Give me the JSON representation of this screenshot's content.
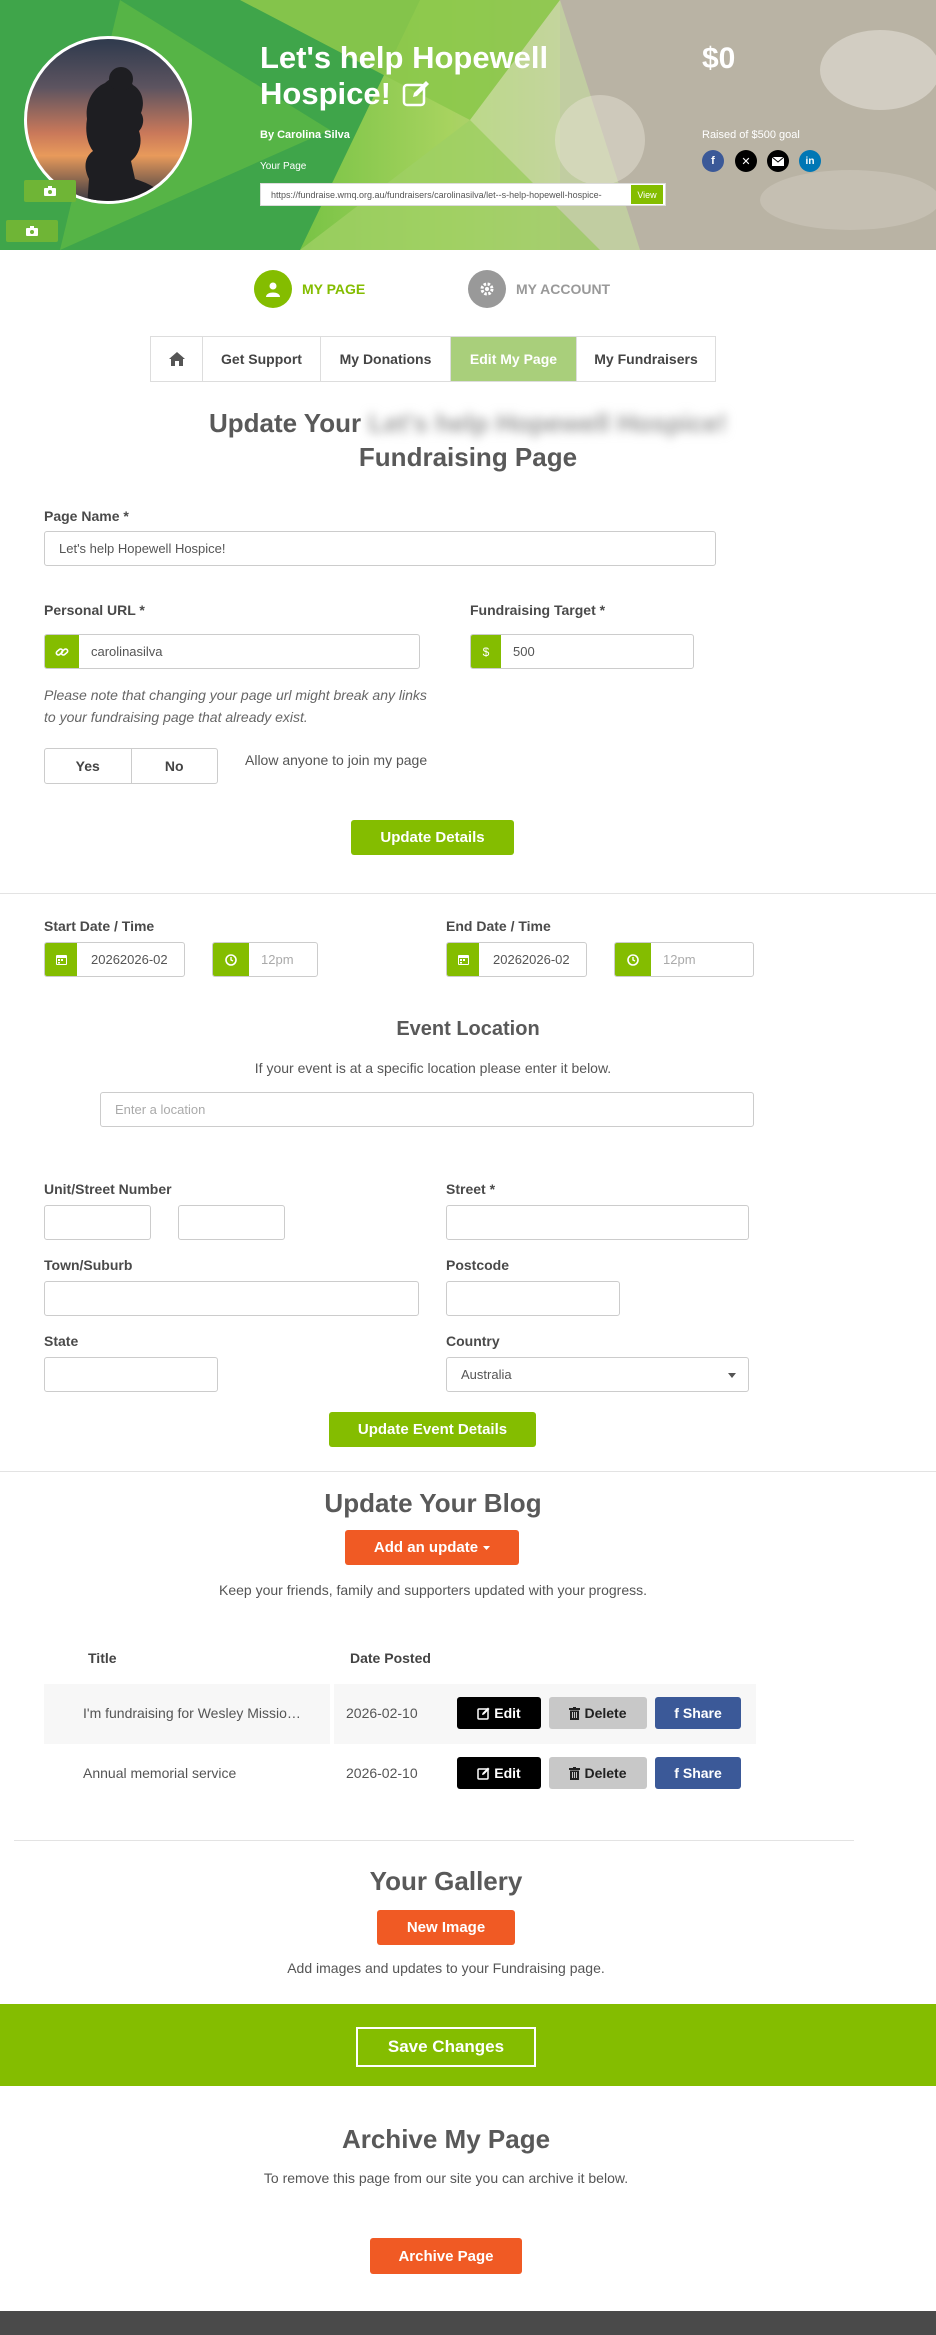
{
  "hero": {
    "title_line1": "Let's help Hopewell",
    "title_line2": "Hospice!",
    "by": "By Carolina Silva",
    "your_page_label": "Your Page",
    "url": "https://fundraise.wmq.org.au/fundraisers/carolinasilva/let--s-help-hopewell-hospice-",
    "view_label": "View",
    "amount": "$0",
    "goal_text": "Raised of $500 goal",
    "social": [
      "facebook-icon",
      "x-icon",
      "email-icon",
      "linkedin-icon"
    ]
  },
  "account_tabs": {
    "my_page": "MY PAGE",
    "my_account": "MY ACCOUNT"
  },
  "nav": {
    "home": "home-icon",
    "items": [
      "Get Support",
      "My Donations",
      "Edit My Page",
      "My Fundraisers"
    ],
    "active": "Edit My Page"
  },
  "update_page": {
    "heading_prefix": "Update Your",
    "heading_blurred": "Let's help Hopewell Hospice!",
    "heading_suffix": "Fundraising Page",
    "page_name_label": "Page Name *",
    "page_name_value": "Let's help Hopewell Hospice!",
    "personal_url_label": "Personal URL *",
    "personal_url_value": "carolinasilva",
    "target_label": "Fundraising Target *",
    "target_prefix": "$",
    "target_value": "500",
    "note": "Please note that changing your page url might break any links to your fundraising page that already exist.",
    "yes": "Yes",
    "no": "No",
    "join_label": "Allow anyone to join my page",
    "update_btn": "Update Details"
  },
  "event": {
    "start_label": "Start Date / Time",
    "start_date": "20262026-02",
    "start_time": "12pm",
    "end_label": "End Date / Time",
    "end_date": "20262026-02",
    "end_time": "12pm",
    "location_heading": "Event Location",
    "location_desc": "If your event is at a specific location please enter it below.",
    "location_placeholder": "Enter a location",
    "unit_label": "Unit/Street Number",
    "street_label": "Street *",
    "town_label": "Town/Suburb",
    "postcode_label": "Postcode",
    "state_label": "State",
    "country_label": "Country",
    "country_value": "Australia",
    "update_btn": "Update Event Details"
  },
  "blog": {
    "heading": "Update Your Blog",
    "add_btn": "Add an update",
    "desc": "Keep your friends, family and supporters updated with your progress.",
    "col_title": "Title",
    "col_date": "Date Posted",
    "edit": "Edit",
    "delete": "Delete",
    "share": "Share",
    "rows": [
      {
        "title": "I'm fundraising for Wesley Missio…",
        "date": "2026-02-10"
      },
      {
        "title": "Annual memorial service",
        "date": "2026-02-10"
      }
    ]
  },
  "gallery": {
    "heading": "Your Gallery",
    "btn": "New Image",
    "desc": "Add images and updates to your Fundraising page."
  },
  "save_btn": "Save Changes",
  "archive": {
    "heading": "Archive My Page",
    "desc": "To remove this page from our site you can archive it below.",
    "btn": "Archive Page"
  },
  "colors": {
    "green": "#84bd00",
    "orange": "#f05a24",
    "facebook": "#3b5998"
  }
}
